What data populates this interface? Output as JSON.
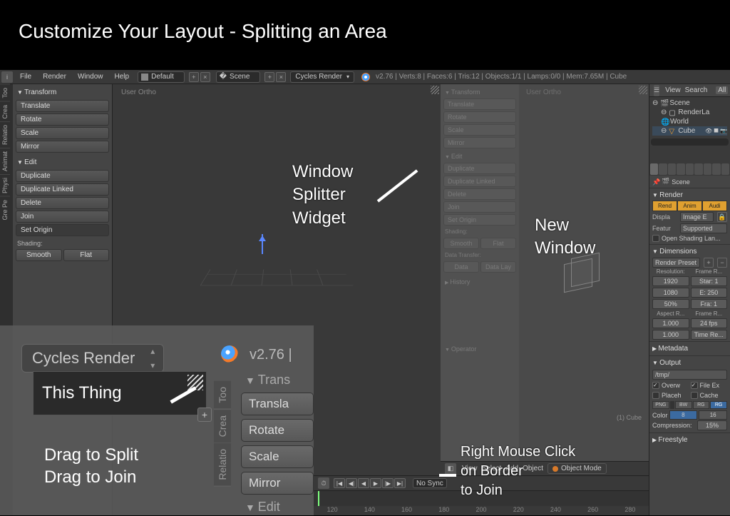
{
  "banner_title": "Customize Your Layout - Splitting an Area",
  "topbar": {
    "menus": [
      "File",
      "Render",
      "Window",
      "Help"
    ],
    "layout": "Default",
    "scene": "Scene",
    "engine": "Cycles Render",
    "stats": "v2.76 | Verts:8 | Faces:6 | Tris:12 | Objects:1/1 | Lamps:0/0 | Mem:7.65M | Cube"
  },
  "tabs": [
    "Too",
    "Crea",
    "Relatio",
    "Animat",
    "Physi",
    "Gre Pe"
  ],
  "transform": {
    "title": "Transform",
    "buttons": [
      "Translate",
      "Rotate",
      "Scale",
      "Mirror"
    ]
  },
  "edit": {
    "title": "Edit",
    "buttons": [
      "Duplicate",
      "Duplicate Linked",
      "Delete",
      "Join"
    ],
    "setorigin": "Set Origin",
    "shading": "Shading:",
    "shbtns": [
      "Smooth",
      "Flat"
    ]
  },
  "viewportL": {
    "label": "User Ortho"
  },
  "viewportR": {
    "label": "User Ortho",
    "transform_title": "Transform",
    "transform": [
      "Translate",
      "Rotate",
      "Scale",
      "Mirror"
    ],
    "edit_title": "Edit",
    "edit": [
      "Duplicate",
      "Duplicate Linked",
      "Delete",
      "Join"
    ],
    "setorigin": "Set Origin",
    "shading": "Shading:",
    "shbtns": [
      "Smooth",
      "Flat"
    ],
    "dt_title": "Data Transfer:",
    "dt": [
      "Data",
      "Data Lay"
    ],
    "history": "History",
    "operator": "Operator",
    "objlabel": "(1) Cube"
  },
  "vpbar": {
    "items": [
      "View",
      "Select",
      "Add",
      "Object"
    ],
    "mode": "Object Mode"
  },
  "timeline": {
    "sync": "No Sync",
    "ticks": [
      "120",
      "140",
      "160",
      "180",
      "200",
      "220",
      "240",
      "260",
      "280"
    ]
  },
  "outliner": {
    "hdr": [
      "View",
      "Search",
      "All"
    ],
    "rows": [
      {
        "icon": "scene-icon",
        "label": "Scene",
        "indent": 0
      },
      {
        "icon": "renderlayer-icon",
        "label": "RenderLa",
        "indent": 1
      },
      {
        "icon": "world-icon",
        "label": "World",
        "indent": 1
      },
      {
        "icon": "mesh-icon",
        "label": "Cube",
        "indent": 1,
        "sel": true
      }
    ]
  },
  "props": {
    "crumb": "Scene",
    "render": {
      "title": "Render",
      "btns": [
        "Rend",
        "Anim",
        "Audi"
      ],
      "display_l": "Displa",
      "display_v": "Image E",
      "feature_l": "Featur",
      "feature_v": "Supported",
      "osl": "Open Shading Lan..."
    },
    "dimensions": {
      "title": "Dimensions",
      "preset": "Render Preset",
      "res_l": "Resolution:",
      "frame_l": "Frame R...",
      "resx": "1920",
      "start": "Star: 1",
      "resy": "1080",
      "end": "E: 250",
      "pct": "50%",
      "step": "Fra: 1",
      "aspect_l": "Aspect R...",
      "rate_l": "Frame R...",
      "ax": "1.000",
      "fps": "24 fps",
      "ay": "1.000",
      "timere": "Time Re..."
    },
    "metadata": "Metadata",
    "output": {
      "title": "Output",
      "path": "/tmp/",
      "overw": "Overw",
      "fileex": "File Ex",
      "placeh": "Placeh",
      "cache": "Cache",
      "fmt": [
        "PNG",
        "",
        "BW",
        "RG",
        "RG"
      ],
      "color_l": "Color",
      "bits": [
        "8",
        "16"
      ],
      "comp_l": "Compression:",
      "comp_v": "15%"
    },
    "freestyle": "Freestyle"
  },
  "annotations": {
    "splitter": "Window\nSplitter\nWidget",
    "newwin": "New\nWindow",
    "rmb": "Right Mouse Click\non Border\nto Join",
    "thisthing": "This Thing",
    "drag": "Drag to Split\nDrag to Join"
  },
  "zoom": {
    "engine": "Cycles Render",
    "version": "v2.76 |",
    "tabs": [
      "Too",
      "Crea",
      "Relatio"
    ],
    "transform": "Trans",
    "btns": [
      "Transla",
      "Rotate",
      "Scale",
      "Mirror"
    ],
    "edit": "Edit"
  }
}
